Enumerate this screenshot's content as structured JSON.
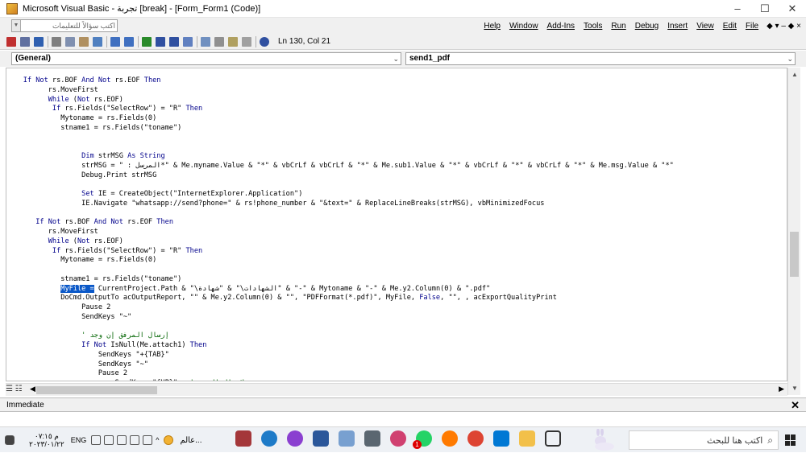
{
  "window": {
    "title": "Microsoft Visual Basic - تجربة [break] - [Form_Form1 (Code)]",
    "controls": {
      "minimize": "–",
      "maximize": "☐",
      "close": "✕"
    }
  },
  "menubar": {
    "help_placeholder": "اكتب سؤالاً للتعليمات",
    "items": [
      "Help",
      "Window",
      "Add-Ins",
      "Tools",
      "Run",
      "Debug",
      "Insert",
      "View",
      "Edit",
      "File"
    ],
    "ctrl_icons": "◆ ▾ – ◆ ×"
  },
  "toolbar": {
    "position": "Ln 130, Col 21"
  },
  "combos": {
    "object": "(General)",
    "procedure": "send1_pdf"
  },
  "code": {
    "lines": [
      [
        {
          "t": "    "
        },
        {
          "t": "If Not",
          "k": 1
        },
        {
          "t": " rs.BOF "
        },
        {
          "t": "And Not",
          "k": 1
        },
        {
          "t": " rs.EOF "
        },
        {
          "t": "Then",
          "k": 1
        }
      ],
      [
        {
          "t": "          rs.MoveFirst"
        }
      ],
      [
        {
          "t": "          "
        },
        {
          "t": "While",
          "k": 1
        },
        {
          "t": " ("
        },
        {
          "t": "Not",
          "k": 1
        },
        {
          "t": " rs.EOF)"
        }
      ],
      [
        {
          "t": "           "
        },
        {
          "t": "If",
          "k": 1
        },
        {
          "t": " rs.Fields(\"SelectRow\") = \"R\" "
        },
        {
          "t": "Then",
          "k": 1
        }
      ],
      [
        {
          "t": "             Mytoname = rs.Fields(0)"
        }
      ],
      [
        {
          "t": "             stname1 = rs.Fields(\"toname\")"
        }
      ],
      [
        {
          "t": ""
        }
      ],
      [
        {
          "t": ""
        }
      ],
      [
        {
          "t": "                  "
        },
        {
          "t": "Dim",
          "k": 1
        },
        {
          "t": " strMSG "
        },
        {
          "t": "As String",
          "k": 1
        }
      ],
      [
        {
          "t": "                  strMSG = \" : المرسل*\" & Me.myname.Value & \"*\" & vbCrLf & vbCrLf & \"*\" & Me.sub1.Value & \"*\" & vbCrLf & \"*\" & vbCrLf & \"*\" & Me.msg.Value & \"*\""
        }
      ],
      [
        {
          "t": "                  Debug.Print strMSG"
        }
      ],
      [
        {
          "t": ""
        }
      ],
      [
        {
          "t": "                  "
        },
        {
          "t": "Set",
          "k": 1
        },
        {
          "t": " IE = CreateObject(\"InternetExplorer.Application\")"
        }
      ],
      [
        {
          "t": "                  IE.Navigate \"whatsapp://send?phone=\" & rs!phone_number & \"&text=\" & ReplaceLineBreaks(strMSG), vbMinimizedFocus"
        }
      ],
      [
        {
          "t": ""
        }
      ],
      [
        {
          "t": "       "
        },
        {
          "t": "If Not",
          "k": 1
        },
        {
          "t": " rs.BOF "
        },
        {
          "t": "And Not",
          "k": 1
        },
        {
          "t": " rs.EOF "
        },
        {
          "t": "Then",
          "k": 1
        }
      ],
      [
        {
          "t": "          rs.MoveFirst"
        }
      ],
      [
        {
          "t": "          "
        },
        {
          "t": "While",
          "k": 1
        },
        {
          "t": " ("
        },
        {
          "t": "Not",
          "k": 1
        },
        {
          "t": " rs.EOF)"
        }
      ],
      [
        {
          "t": "           "
        },
        {
          "t": "If",
          "k": 1
        },
        {
          "t": " rs.Fields(\"SelectRow\") = \"R\" "
        },
        {
          "t": "Then",
          "k": 1
        }
      ],
      [
        {
          "t": "             Mytoname = rs.Fields(0)"
        }
      ],
      [
        {
          "t": ""
        }
      ],
      [
        {
          "t": "             stname1 = rs.Fields(\"toname\")"
        }
      ],
      [
        {
          "t": "             "
        },
        {
          "t": "MyFile =",
          "s": 1
        },
        {
          "t": " CurrentProject.Path & \"\\الشهادات\\\" & \"شهادة\" & \"-\" & Mytoname & \"-\" & Me.y2.Column(0) & \".pdf\""
        }
      ],
      [
        {
          "t": "             DoCmd.OutputTo acOutputReport, \"\" & Me.y2.Column(0) & \"\", \"PDFFormat(*.pdf)\", MyFile, "
        },
        {
          "t": "False",
          "k": 1
        },
        {
          "t": ", \"\", , acExportQualityPrint"
        }
      ],
      [
        {
          "t": "                  Pause 2"
        }
      ],
      [
        {
          "t": "                  SendKeys \"~\""
        }
      ],
      [
        {
          "t": ""
        }
      ],
      [
        {
          "t": "                  ",
          "c": 0
        },
        {
          "t": "' إرسال المرفق إن وجد",
          "c": 1
        }
      ],
      [
        {
          "t": "                  "
        },
        {
          "t": "If Not",
          "k": 1
        },
        {
          "t": " IsNull(Me.attach1) "
        },
        {
          "t": "Then",
          "k": 1
        }
      ],
      [
        {
          "t": "                      SendKeys \"+{TAB}\""
        }
      ],
      [
        {
          "t": "                      SendKeys \"~\""
        }
      ],
      [
        {
          "t": "                      Pause 2"
        }
      ],
      [
        {
          "t": "                          SendKeys \"{UP}\"   "
        },
        {
          "t": "' لإرسال الصور",
          "c": 1
        }
      ]
    ]
  },
  "immediate": {
    "label": "Immediate",
    "close": "✕"
  },
  "taskbar": {
    "clock_time": "م ٠٧:١٥",
    "clock_date": "٢٠٢٣/٠١/٢٢",
    "language": "ENG",
    "weather": "عالم...",
    "search_placeholder": "اكتب هنا للبحث",
    "badge": "1"
  }
}
